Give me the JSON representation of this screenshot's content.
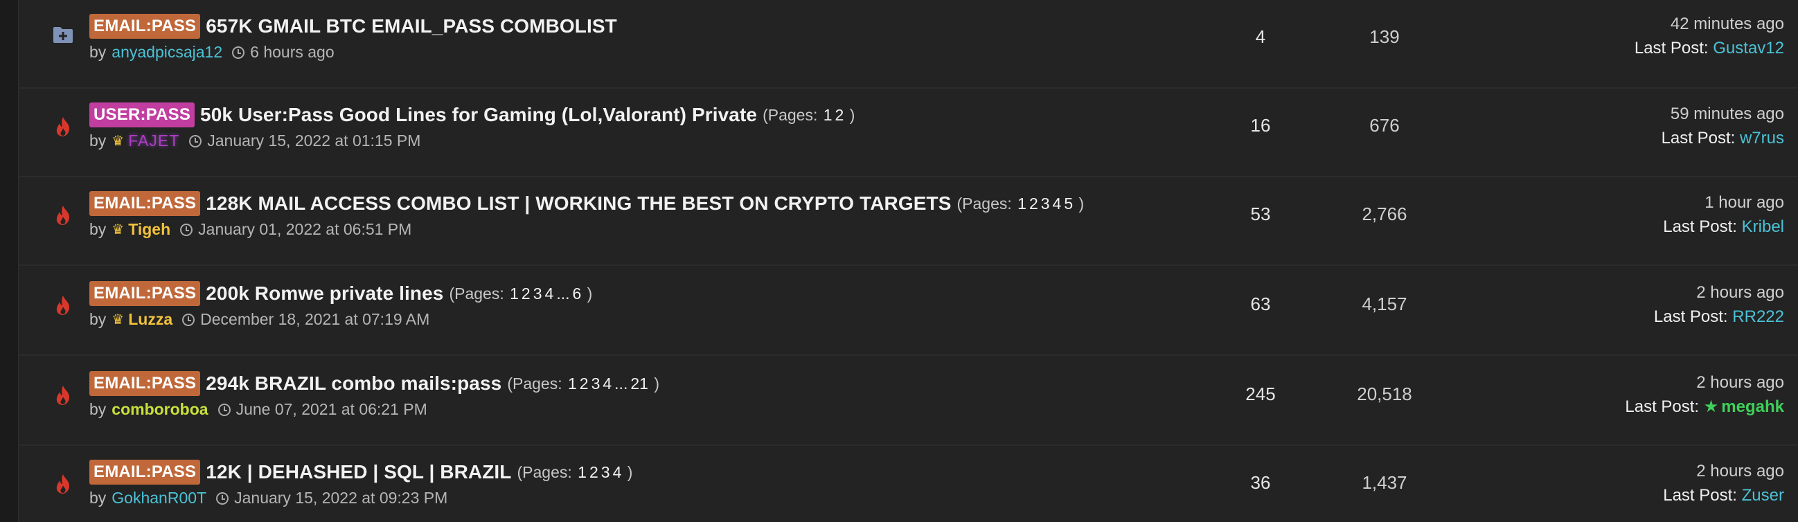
{
  "threads": [
    {
      "icon": "folder-plus-icon",
      "prefix": "EMAIL:PASS",
      "title": "657K GMAIL BTC EMAIL_PASS COMBOLIST",
      "pages_label": "",
      "pages": [],
      "by": "by",
      "author": "anyadpicsaja12",
      "date": "6 hours ago",
      "replies": "4",
      "views": "139",
      "last_time": "42 minutes ago",
      "last_label": "Last Post:",
      "last_user": "Gustav12"
    },
    {
      "icon": "fire-icon",
      "prefix": "USER:PASS",
      "title": "50k User:Pass Good Lines for Gaming (Lol,Valorant) Private",
      "pages_open": "(Pages:",
      "pages": [
        "1",
        "2"
      ],
      "pages_close": ")",
      "by": "by",
      "author": "FAJET",
      "date": "January 15, 2022 at 01:15 PM",
      "replies": "16",
      "views": "676",
      "last_time": "59 minutes ago",
      "last_label": "Last Post:",
      "last_user": "w7rus"
    },
    {
      "icon": "fire-icon",
      "prefix": "EMAIL:PASS",
      "title": "128K MAIL ACCESS COMBO LIST | WORKING THE BEST ON CRYPTO TARGETS",
      "pages_open": "(Pages:",
      "pages": [
        "1",
        "2",
        "3",
        "4",
        "5"
      ],
      "pages_close": ")",
      "by": "by",
      "author": "Tigeh",
      "date": "January 01, 2022 at 06:51 PM",
      "replies": "53",
      "views": "2,766",
      "last_time": "1 hour ago",
      "last_label": "Last Post:",
      "last_user": "Kribel"
    },
    {
      "icon": "fire-icon",
      "prefix": "EMAIL:PASS",
      "title": "200k Romwe private lines",
      "pages_open": "(Pages:",
      "pages": [
        "1",
        "2",
        "3",
        "4",
        "...",
        "6"
      ],
      "pages_close": ")",
      "by": "by",
      "author": "Luzza",
      "date": "December 18, 2021 at 07:19 AM",
      "replies": "63",
      "views": "4,157",
      "last_time": "2 hours ago",
      "last_label": "Last Post:",
      "last_user": "RR222"
    },
    {
      "icon": "fire-icon",
      "prefix": "EMAIL:PASS",
      "title": "294k BRAZIL combo mails:pass",
      "pages_open": "(Pages:",
      "pages": [
        "1",
        "2",
        "3",
        "4",
        "...",
        "21"
      ],
      "pages_close": ")",
      "by": "by",
      "author": "comboroboa",
      "date": "June 07, 2021 at 06:21 PM",
      "replies": "245",
      "views": "20,518",
      "last_time": "2 hours ago",
      "last_label": "Last Post:",
      "last_user": "megahk"
    },
    {
      "icon": "fire-icon",
      "prefix": "EMAIL:PASS",
      "title": "12K | DEHASHED | SQL | BRAZIL",
      "pages_open": "(Pages:",
      "pages": [
        "1",
        "2",
        "3",
        "4"
      ],
      "pages_close": ")",
      "by": "by",
      "author": "GokhanR00T",
      "date": "January 15, 2022 at 09:23 PM",
      "replies": "36",
      "views": "1,437",
      "last_time": "2 hours ago",
      "last_label": "Last Post:",
      "last_user": "Zuser"
    }
  ],
  "colors": {
    "background": "#232323",
    "prefix_email": "#c0683a",
    "prefix_user": "#c13ea0",
    "username_blue": "#4cc2d6",
    "username_gold": "#f1c33c",
    "username_lime": "#c9e03c",
    "username_purple": "#b13cc4",
    "username_green": "#3fcf5a",
    "fire_icon": "#d7382b"
  }
}
